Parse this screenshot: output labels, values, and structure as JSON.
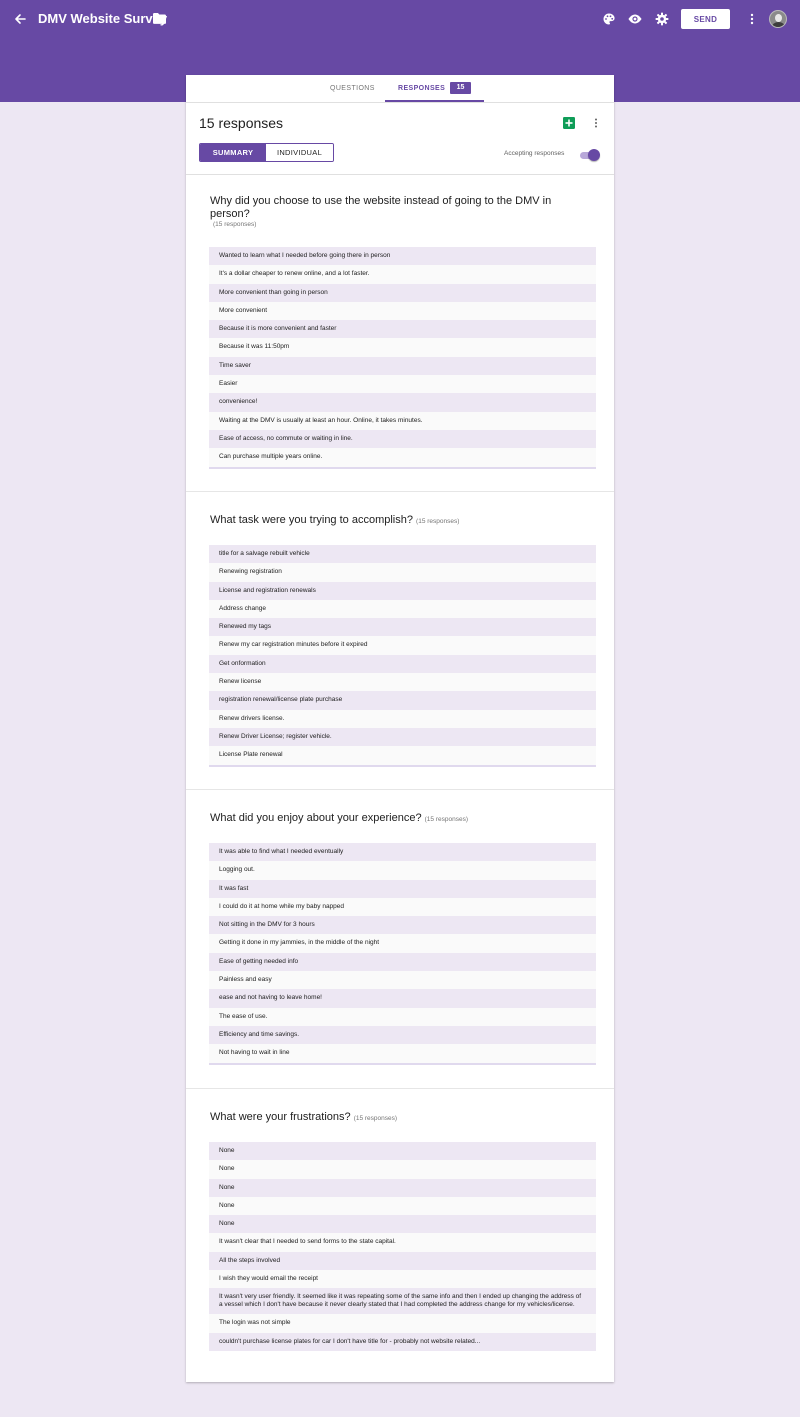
{
  "app": {
    "title": "DMV Website Survey",
    "send_label": "SEND",
    "accent_color": "#6749a4",
    "icons": [
      "back-arrow-icon",
      "folder-icon",
      "palette-icon",
      "eye-icon",
      "gear-icon",
      "more-vert-icon",
      "avatar"
    ]
  },
  "tabs": {
    "questions": "QUESTIONS",
    "responses": "RESPONSES",
    "responses_count": "15"
  },
  "summary": {
    "title": "15 responses",
    "summary_label": "SUMMARY",
    "individual_label": "INDIVIDUAL",
    "accepting_label": "Accepting responses",
    "accepting_on": true
  },
  "questions": [
    {
      "title": "Why did you choose to use the website instead of going to the DMV in person?",
      "count": "(15 responses)",
      "answers": [
        "Wanted to learn what I needed before going there in person",
        "It's a dollar cheaper to renew online, and a lot faster.",
        "More convenient than going in person",
        "More convenient",
        "Because it is more convenient and faster",
        "Because it was 11:50pm",
        "Time saver",
        "Easier",
        "convenience!",
        "Waiting at the DMV is usually at least an hour. Online, it takes minutes.",
        "Ease of access, no commute or waiting in line.",
        "Can purchase multiple years online."
      ]
    },
    {
      "title": "What task were you trying to accomplish?",
      "count": "(15 responses)",
      "answers": [
        "title for a salvage rebuilt vehicle",
        "Renewing registration",
        "License and registration renewals",
        "Address change",
        "Renewed my tags",
        "Renew my car registration minutes before it expired",
        "Get onformation",
        "Renew license",
        "registration renewal/license plate purchase",
        "Renew drivers license.",
        "Renew Driver License; register vehicle.",
        "License Plate renewal"
      ]
    },
    {
      "title": "What did you enjoy about your experience?",
      "count": "(15 responses)",
      "answers": [
        "It was able to find what I needed eventually",
        "Logging out.",
        "It was fast",
        "I could do it at home while my baby napped",
        "Not sitting in the DMV for 3 hours",
        "Getting it done in my jammies, in the middle of the night",
        "Ease of getting needed info",
        "Painless and easy",
        "ease and not having to leave home!",
        "The ease of use.",
        "Efficiency and time savings.",
        "Not having to wait in line"
      ]
    },
    {
      "title": "What were your frustrations?",
      "count": "(15 responses)",
      "answers": [
        "None",
        "None",
        "None",
        "None",
        "None",
        "It wasn't clear that I needed to send forms to the state capital.",
        "All the steps involved",
        "I wish they would email the receipt",
        "It wasn't very user friendly. It seemed like it was repeating some of the same info and then I ended up changing the address of a vessel which I don't have because it never clearly stated that I had completed the address change for my vehicles/license.",
        "The login was not simple",
        "couldn't purchase license plates for car I don't have title for - probably not website related..."
      ]
    }
  ]
}
